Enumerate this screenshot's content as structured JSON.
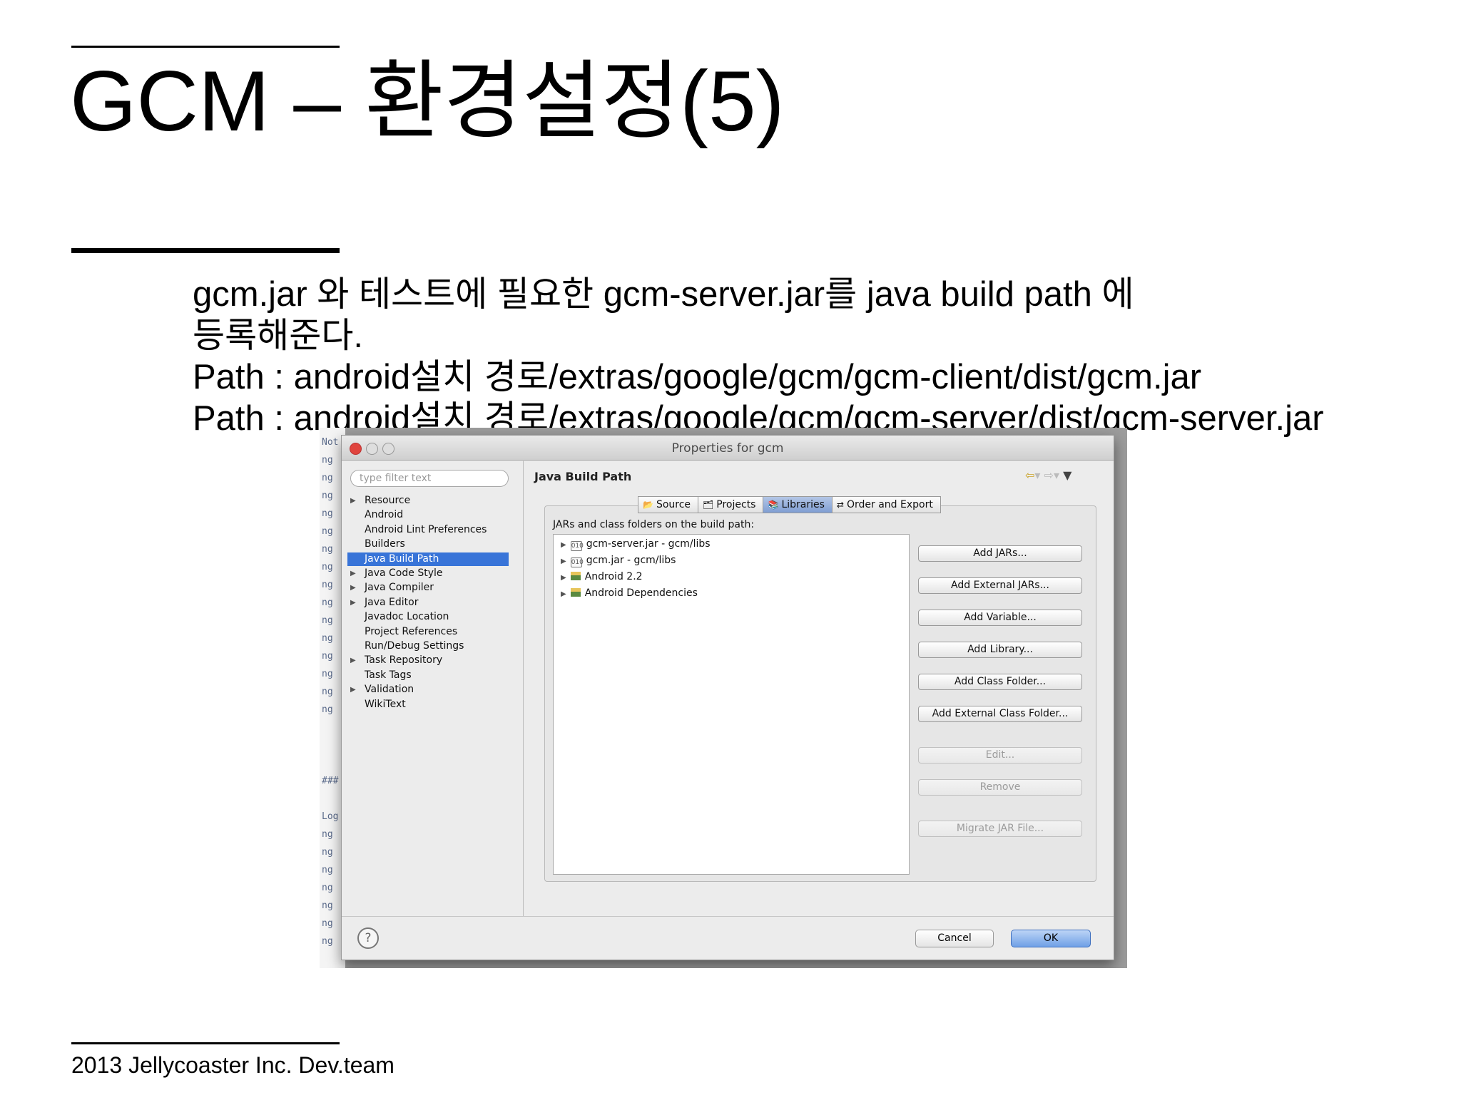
{
  "slide": {
    "title": "GCM – 환경설정(5)",
    "lines": [
      "gcm.jar 와 테스트에 필요한 gcm-server.jar를 java build path 에",
      "등록해준다.",
      "Path : android설치 경로/extras/google/gcm/gcm-client/dist/gcm.jar",
      "Path : android설치 경로/extras/google/gcm/gcm-server/dist/gcm-server.jar"
    ],
    "footer": "2013 Jellycoaster Inc. Dev.team"
  },
  "editor_gutter": [
    "Not",
    "ng",
    "ng",
    "ng",
    "ng",
    "ng",
    "ng",
    "ng",
    "ng",
    "ng",
    "ng",
    "ng",
    "ng",
    "ng",
    "ng",
    "ng",
    "###",
    "Log",
    "ng",
    "ng",
    "ng",
    "ng",
    "ng",
    "ng",
    "ng"
  ],
  "dialog": {
    "title": "Properties for gcm",
    "filter_placeholder": "type filter text",
    "tree": [
      {
        "label": "Resource",
        "expandable": true
      },
      {
        "label": "Android",
        "expandable": false
      },
      {
        "label": "Android Lint Preferences",
        "expandable": false
      },
      {
        "label": "Builders",
        "expandable": false
      },
      {
        "label": "Java Build Path",
        "expandable": false,
        "selected": true
      },
      {
        "label": "Java Code Style",
        "expandable": true
      },
      {
        "label": "Java Compiler",
        "expandable": true
      },
      {
        "label": "Java Editor",
        "expandable": true
      },
      {
        "label": "Javadoc Location",
        "expandable": false
      },
      {
        "label": "Project References",
        "expandable": false
      },
      {
        "label": "Run/Debug Settings",
        "expandable": false
      },
      {
        "label": "Task Repository",
        "expandable": true
      },
      {
        "label": "Task Tags",
        "expandable": false
      },
      {
        "label": "Validation",
        "expandable": true
      },
      {
        "label": "WikiText",
        "expandable": false
      }
    ],
    "page_heading": "Java Build Path",
    "tabs": [
      {
        "label": "Source",
        "icon": "source-folder-icon"
      },
      {
        "label": "Projects",
        "icon": "projects-icon"
      },
      {
        "label": "Libraries",
        "icon": "libraries-icon",
        "active": true
      },
      {
        "label": "Order and Export",
        "icon": "order-export-icon"
      }
    ],
    "list_label": "JARs and class folders on the build path:",
    "entries": [
      {
        "label": "gcm-server.jar - gcm/libs",
        "icon": "jar-icon"
      },
      {
        "label": "gcm.jar - gcm/libs",
        "icon": "jar-icon"
      },
      {
        "label": "Android 2.2",
        "icon": "library-icon"
      },
      {
        "label": "Android Dependencies",
        "icon": "library-icon"
      }
    ],
    "buttons": [
      {
        "label": "Add JARs...",
        "enabled": true
      },
      {
        "label": "Add External JARs...",
        "enabled": true
      },
      {
        "label": "Add Variable...",
        "enabled": true
      },
      {
        "label": "Add Library...",
        "enabled": true
      },
      {
        "label": "Add Class Folder...",
        "enabled": true
      },
      {
        "label": "Add External Class Folder...",
        "enabled": true
      },
      {
        "label": "Edit...",
        "enabled": false
      },
      {
        "label": "Remove",
        "enabled": false
      },
      {
        "label": "Migrate JAR File...",
        "enabled": false
      }
    ],
    "cancel_label": "Cancel",
    "ok_label": "OK",
    "colors": {
      "selection": "#3874d8",
      "close": "#e0443e",
      "minimize": "#dedede",
      "zoom": "#dedede"
    }
  }
}
